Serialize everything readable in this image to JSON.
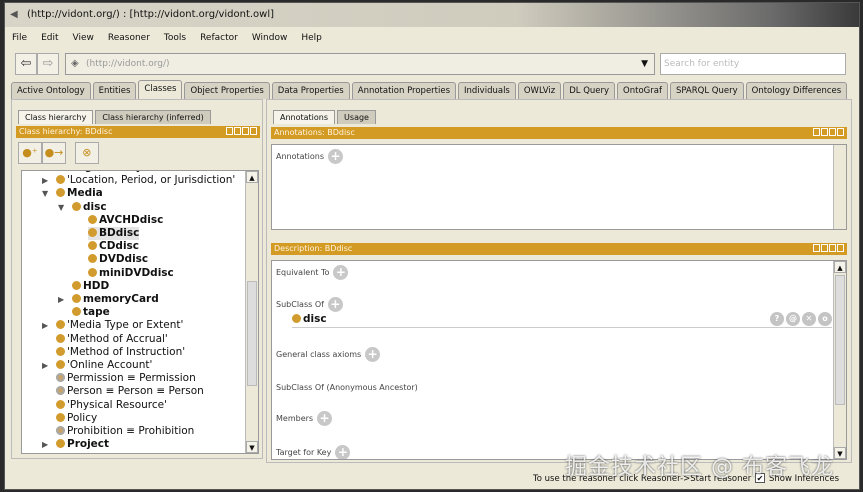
{
  "window": {
    "title": "(http://vidont.org/)  : [http://vidont.org/vidont.owl]"
  },
  "menu": [
    "File",
    "Edit",
    "View",
    "Reasoner",
    "Tools",
    "Refactor",
    "Window",
    "Help"
  ],
  "toolbar": {
    "back": "⇦",
    "forward": "⇨",
    "iri": "(http://vidont.org/)",
    "search_placeholder": "Search for entity"
  },
  "tabs": [
    "Active Ontology",
    "Entities",
    "Classes",
    "Object Properties",
    "Data Properties",
    "Annotation Properties",
    "Individuals",
    "OWLViz",
    "DL Query",
    "OntoGraf",
    "SPARQL Query",
    "Ontology Differences"
  ],
  "active_tab": "Classes",
  "left": {
    "subtabs": [
      "Class hierarchy",
      "Class hierarchy (inferred)"
    ],
    "header": "Class hierarchy: BDdisc",
    "tree": [
      {
        "label": "Linguistic System",
        "level": 0,
        "bold": true,
        "expander": "",
        "partial": true
      },
      {
        "label": "'Location, Period, or Jurisdiction'",
        "level": 0,
        "bold": false,
        "expander": "▶"
      },
      {
        "label": "Media",
        "level": 0,
        "bold": true,
        "expander": "▼"
      },
      {
        "label": "disc",
        "level": 1,
        "bold": true,
        "expander": "▼"
      },
      {
        "label": "AVCHDdisc",
        "level": 2,
        "bold": true,
        "expander": ""
      },
      {
        "label": "BDdisc",
        "level": 2,
        "bold": true,
        "expander": "",
        "selected": true
      },
      {
        "label": "CDdisc",
        "level": 2,
        "bold": true,
        "expander": ""
      },
      {
        "label": "DVDdisc",
        "level": 2,
        "bold": true,
        "expander": ""
      },
      {
        "label": "miniDVDdisc",
        "level": 2,
        "bold": true,
        "expander": ""
      },
      {
        "label": "HDD",
        "level": 1,
        "bold": true,
        "expander": ""
      },
      {
        "label": "memoryCard",
        "level": 1,
        "bold": true,
        "expander": "▶"
      },
      {
        "label": "tape",
        "level": 1,
        "bold": true,
        "expander": ""
      },
      {
        "label": "'Media Type or Extent'",
        "level": 0,
        "bold": false,
        "expander": "▶"
      },
      {
        "label": "'Method of Accrual'",
        "level": 0,
        "bold": false,
        "expander": ""
      },
      {
        "label": "'Method of Instruction'",
        "level": 0,
        "bold": false,
        "expander": ""
      },
      {
        "label": "'Online Account'",
        "level": 0,
        "bold": false,
        "expander": "▶"
      },
      {
        "label": "Permission ≡ Permission",
        "level": 0,
        "bold": false,
        "expander": "",
        "defined": true
      },
      {
        "label": "Person ≡ Person ≡ Person",
        "level": 0,
        "bold": false,
        "expander": "",
        "defined": true
      },
      {
        "label": "'Physical Resource'",
        "level": 0,
        "bold": false,
        "expander": ""
      },
      {
        "label": "Policy",
        "level": 0,
        "bold": false,
        "expander": ""
      },
      {
        "label": "Prohibition ≡ Prohibition",
        "level": 0,
        "bold": false,
        "expander": "",
        "defined": true
      },
      {
        "label": "Project",
        "level": 0,
        "bold": true,
        "expander": "▶"
      }
    ]
  },
  "right": {
    "subtabs": [
      "Annotations",
      "Usage"
    ],
    "annotations_header": "Annotations: BDdisc",
    "annotations_label": "Annotations",
    "description_header": "Description: BDdisc",
    "sections": {
      "equivalent": "Equivalent To",
      "subclass": "SubClass Of",
      "subclass_value": "disc",
      "general": "General class axioms",
      "anon": "SubClass Of (Anonymous Ancestor)",
      "members": "Members",
      "target": "Target for Key"
    },
    "row_actions": [
      "?",
      "@",
      "✕",
      "o"
    ]
  },
  "status": {
    "message": "To use the reasoner click Reasoner->Start reasoner",
    "show_inferences": "Show Inferences",
    "show_inferences_checked": true
  },
  "watermark": "掘金技术社区 @ 布客飞龙"
}
